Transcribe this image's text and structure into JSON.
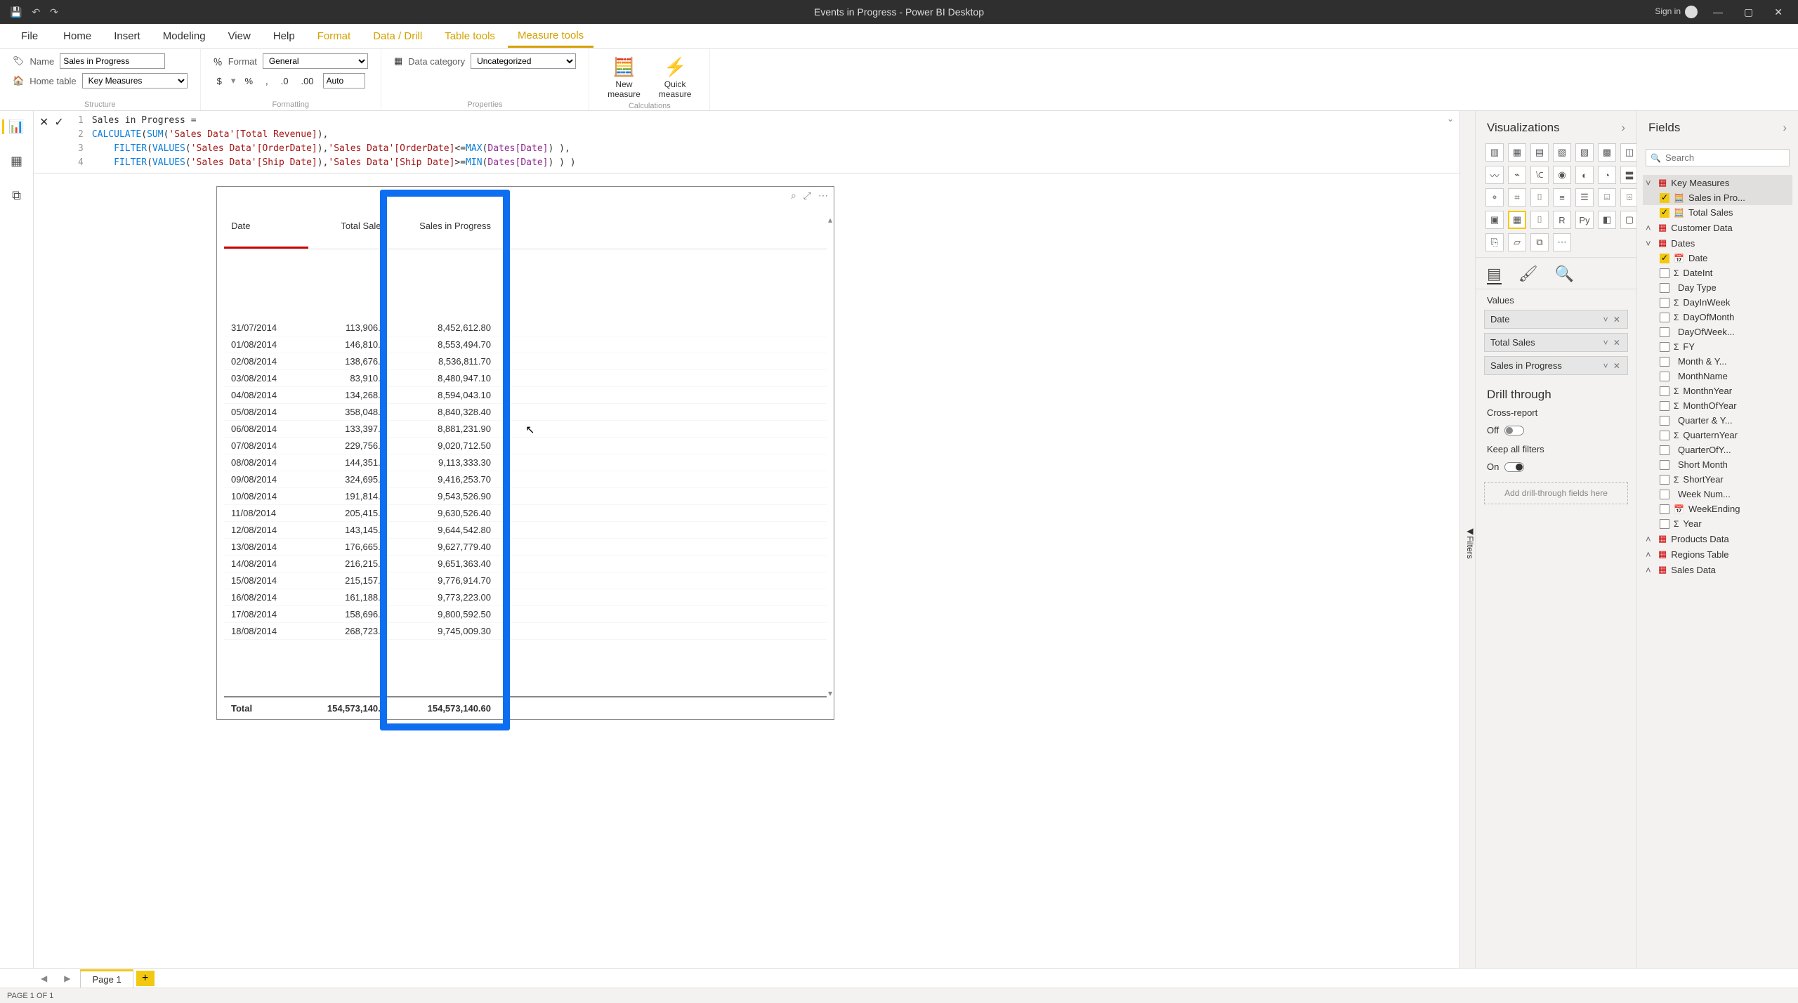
{
  "titlebar": {
    "title": "Events in Progress - Power BI Desktop",
    "signin": "Sign in"
  },
  "tabs": {
    "file": "File",
    "home": "Home",
    "insert": "Insert",
    "modeling": "Modeling",
    "view": "View",
    "help": "Help",
    "format": "Format",
    "datadrill": "Data / Drill",
    "tabletools": "Table tools",
    "measuretools": "Measure tools"
  },
  "structure": {
    "nameLabel": "Name",
    "nameValue": "Sales in Progress",
    "homeTableLabel": "Home table",
    "homeTableValue": "Key Measures",
    "group": "Structure"
  },
  "formatting": {
    "formatLabel": "Format",
    "formatValue": "General",
    "decimalsValue": "Auto",
    "group": "Formatting",
    "currency": "$",
    "percent": "%",
    "comma": ",",
    "dec1": ".0",
    "dec2": ".00"
  },
  "properties": {
    "dataCatLabel": "Data category",
    "dataCatValue": "Uncategorized",
    "group": "Properties"
  },
  "calculations": {
    "newMeasure": "New\nmeasure",
    "quickMeasure": "Quick\nmeasure",
    "group": "Calculations"
  },
  "formula": {
    "l1a": "Sales in Progress =",
    "l2_fn1": "CALCULATE",
    "l2_p1": "( ",
    "l2_fn2": "SUM",
    "l2_p2": "( ",
    "l2_c1": "'Sales Data'[Total Revenue]",
    "l2_p3": " ),",
    "l3_fn1": "FILTER",
    "l3_p1": "( ",
    "l3_fn2": "VALUES",
    "l3_p2": "( ",
    "l3_c1": "'Sales Data'[OrderDate]",
    "l3_p3": " ), ",
    "l3_c2": "'Sales Data'[OrderDate]",
    "l3_p4": " <= ",
    "l3_fn3": "MAX",
    "l3_p5": "( ",
    "l3_c3": "Dates[Date]",
    "l3_p6": " ) ),",
    "l4_fn1": "FILTER",
    "l4_p1": "( ",
    "l4_fn2": "VALUES",
    "l4_p2": "( ",
    "l4_c1": "'Sales Data'[Ship Date]",
    "l4_p3": " ), ",
    "l4_c2": "'Sales Data'[Ship Date]",
    "l4_p4": " >= ",
    "l4_fn3": "MIN",
    "l4_p5": "( ",
    "l4_c3": "Dates[Date]",
    "l4_p6": " ) ) )"
  },
  "vizpanel": {
    "title": "Visualizations",
    "valuesLabel": "Values",
    "drillTitle": "Drill through",
    "crossReport": "Cross-report",
    "offLabel": "Off",
    "keepFilters": "Keep all filters",
    "onLabel": "On",
    "dropHint": "Add drill-through fields here"
  },
  "valueWells": [
    "Date",
    "Total Sales",
    "Sales in Progress"
  ],
  "fieldspanel": {
    "title": "Fields",
    "searchPlaceholder": "Search"
  },
  "tables": {
    "keyMeasures": "Key Measures",
    "keyMeasuresFields": [
      "Sales in Pro...",
      "Total Sales"
    ],
    "customerData": "Customer Data",
    "dates": "Dates",
    "datesFields": [
      "Date",
      "DateInt",
      "Day Type",
      "DayInWeek",
      "DayOfMonth",
      "DayOfWeek...",
      "FY",
      "Month & Y...",
      "MonthName",
      "MonthnYear",
      "MonthOfYear",
      "Quarter & Y...",
      "QuarternYear",
      "QuarterOfY...",
      "Short Month",
      "ShortYear",
      "Week Num...",
      "WeekEnding",
      "Year"
    ],
    "productsData": "Products Data",
    "regionsTable": "Regions Table",
    "salesData": "Sales Data"
  },
  "datesMeta": {
    "checked": {
      "Date": true
    },
    "sigma": {
      "DateInt": true,
      "DayInWeek": true,
      "DayOfMonth": true,
      "FY": true,
      "MonthnYear": true,
      "MonthOfYear": true,
      "QuarternYear": true,
      "ShortYear": true,
      "Year": true
    },
    "calendar": {
      "Date": true,
      "WeekEnding": true
    }
  },
  "chart_data": {
    "type": "table",
    "columns": [
      "Date",
      "Total Sales",
      "Sales in Progress"
    ],
    "rows": [
      [
        "31/07/2014",
        "113,906.7",
        "8,452,612.80"
      ],
      [
        "01/08/2014",
        "146,810.4",
        "8,553,494.70"
      ],
      [
        "02/08/2014",
        "138,676.6",
        "8,536,811.70"
      ],
      [
        "03/08/2014",
        "83,910.8",
        "8,480,947.10"
      ],
      [
        "04/08/2014",
        "134,268.0",
        "8,594,043.10"
      ],
      [
        "05/08/2014",
        "358,048.0",
        "8,840,328.40"
      ],
      [
        "06/08/2014",
        "133,397.0",
        "8,881,231.90"
      ],
      [
        "07/08/2014",
        "229,756.4",
        "9,020,712.50"
      ],
      [
        "08/08/2014",
        "144,351.5",
        "9,113,333.30"
      ],
      [
        "09/08/2014",
        "324,695.4",
        "9,416,253.70"
      ],
      [
        "10/08/2014",
        "191,814.3",
        "9,543,526.90"
      ],
      [
        "11/08/2014",
        "205,415.3",
        "9,630,526.40"
      ],
      [
        "12/08/2014",
        "143,145.5",
        "9,644,542.80"
      ],
      [
        "13/08/2014",
        "176,665.6",
        "9,627,779.40"
      ],
      [
        "14/08/2014",
        "216,215.7",
        "9,651,363.40"
      ],
      [
        "15/08/2014",
        "215,157.1",
        "9,776,914.70"
      ],
      [
        "16/08/2014",
        "161,188.6",
        "9,773,223.00"
      ],
      [
        "17/08/2014",
        "158,696.2",
        "9,800,592.50"
      ],
      [
        "18/08/2014",
        "268,723.6",
        "9,745,009.30"
      ]
    ],
    "totals": [
      "Total",
      "154,573,140.6",
      "154,573,140.60"
    ]
  },
  "filtersLabel": "Filters",
  "pagetab": "Page 1",
  "statusbar": "PAGE 1 OF 1"
}
